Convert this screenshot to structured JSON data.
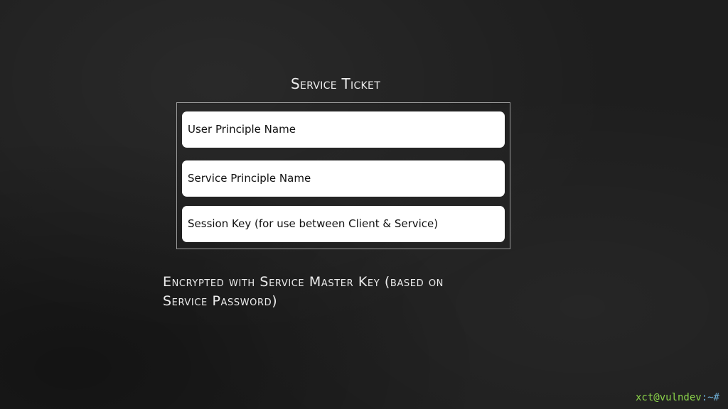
{
  "title": "Service Ticket",
  "ticket": {
    "fields": [
      "User Principle Name",
      "Service Principle Name",
      "Session Key (for use between Client & Service)"
    ]
  },
  "note": {
    "line1": "Encrypted with Service Master Key (based on",
    "line2": "Service Password)"
  },
  "watermark": {
    "user_host": "xct@vulndev",
    "suffix": ":~#"
  },
  "colors": {
    "background": "#1e1e1e",
    "field_fill": "#ffffff",
    "frame_border": "#9a9a9a",
    "text_light": "#ececec",
    "watermark_green": "#8bd44a",
    "watermark_blue": "#6fb0d8"
  }
}
